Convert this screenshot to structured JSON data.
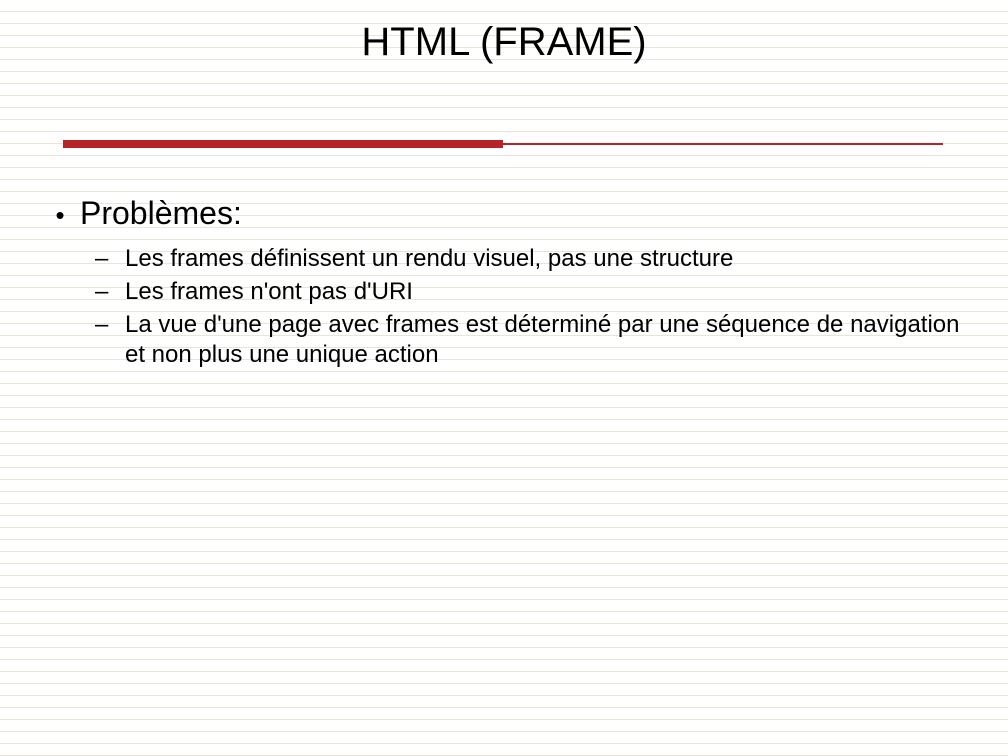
{
  "title": "HTML (FRAME)",
  "main": {
    "heading": "Problèmes:",
    "items": [
      "Les frames définissent un rendu visuel, pas une structure",
      "Les frames n'ont pas d'URI",
      "La vue d'une page avec frames est déterminé par une séquence de navigation et non plus une unique action"
    ]
  }
}
